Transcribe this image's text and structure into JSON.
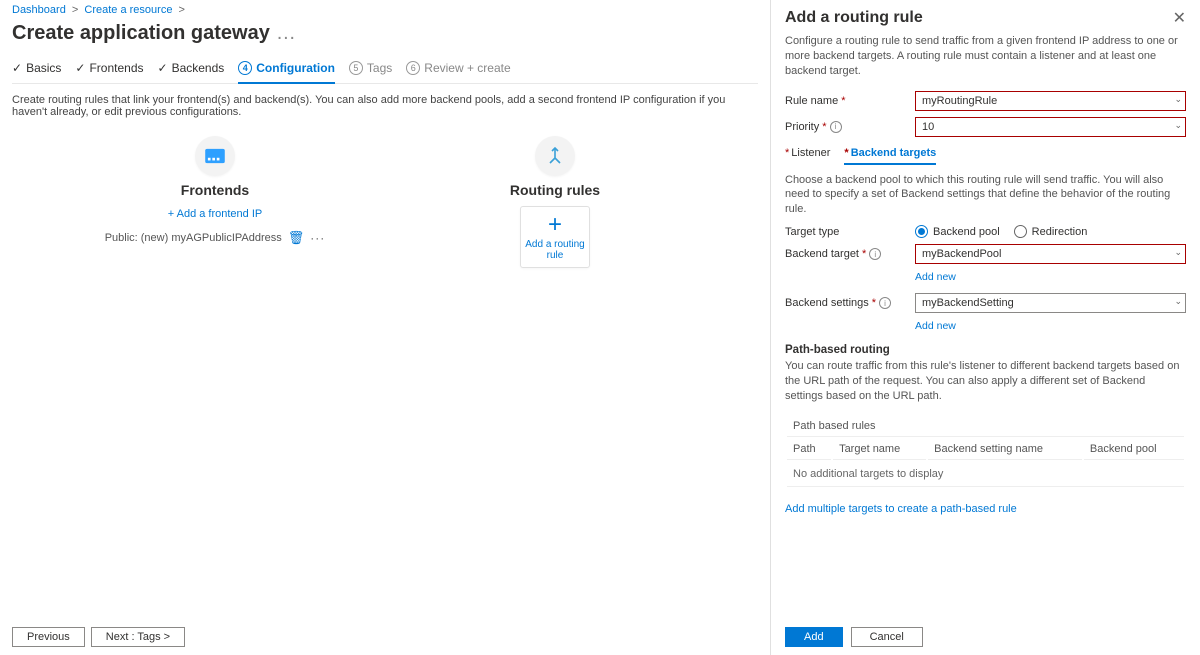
{
  "breadcrumb": {
    "item1": "Dashboard",
    "item2": "Create a resource"
  },
  "page_title": "Create application gateway",
  "wizard": {
    "basics": "Basics",
    "frontends": "Frontends",
    "backends": "Backends",
    "configuration": "Configuration",
    "tags_num": "5",
    "tags": "Tags",
    "review_num": "6",
    "review": "Review + create"
  },
  "config_desc": "Create routing rules that link your frontend(s) and backend(s). You can also add more backend pools, add a second frontend IP configuration if you haven't already, or edit previous configurations.",
  "frontends": {
    "title": "Frontends",
    "add_link": "+ Add a frontend IP",
    "entry": "Public: (new) myAGPublicIPAddress"
  },
  "routing": {
    "title": "Routing rules",
    "add_label": "Add a routing rule"
  },
  "footer": {
    "prev": "Previous",
    "next": "Next : Tags >"
  },
  "panel": {
    "title": "Add a routing rule",
    "intro": "Configure a routing rule to send traffic from a given frontend IP address to one or more backend targets. A routing rule must contain a listener and at least one backend target.",
    "rule_name_label": "Rule name",
    "rule_name_value": "myRoutingRule",
    "priority_label": "Priority",
    "priority_value": "10",
    "tab_listener": "Listener",
    "tab_backend": "Backend targets",
    "backend_help": "Choose a backend pool to which this routing rule will send traffic. You will also need to specify a set of Backend settings that define the behavior of the routing rule.",
    "target_type_label": "Target type",
    "target_type_backend": "Backend pool",
    "target_type_redirect": "Redirection",
    "backend_target_label": "Backend target",
    "backend_target_value": "myBackendPool",
    "add_new": "Add new",
    "backend_settings_label": "Backend settings",
    "backend_settings_value": "myBackendSetting",
    "path_routing_head": "Path-based routing",
    "path_routing_help": "You can route traffic from this rule's listener to different backend targets based on the URL path of the request. You can also apply a different set of Backend settings based on the URL path.",
    "table": {
      "col_rules": "Path based rules",
      "col_path": "Path",
      "col_target": "Target name",
      "col_setting": "Backend setting name",
      "col_pool": "Backend pool",
      "empty": "No additional targets to display"
    },
    "add_multiple": "Add multiple targets to create a path-based rule",
    "add": "Add",
    "cancel": "Cancel"
  }
}
